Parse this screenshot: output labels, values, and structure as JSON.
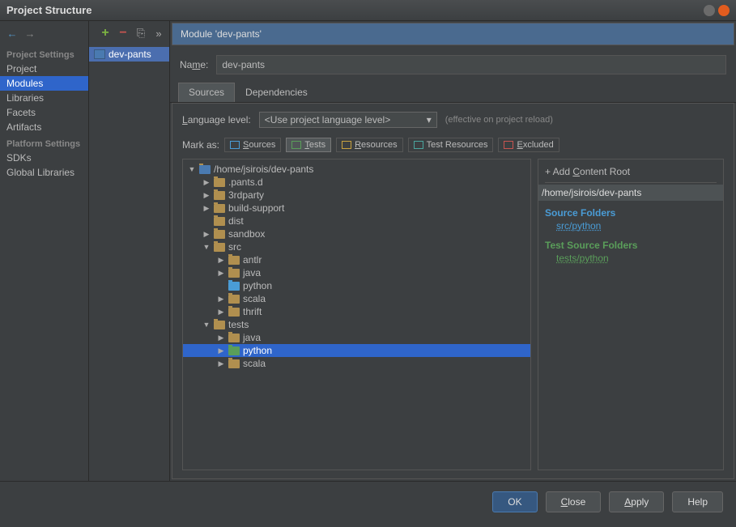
{
  "window": {
    "title": "Project Structure"
  },
  "nav": {
    "left_icon": "←",
    "right_icon": "→"
  },
  "sidebar": {
    "group1": "Project Settings",
    "items1": [
      "Project",
      "Modules",
      "Libraries",
      "Facets",
      "Artifacts"
    ],
    "group2": "Platform Settings",
    "items2": [
      "SDKs",
      "Global Libraries"
    ],
    "selected": "Modules"
  },
  "mid": {
    "module": "dev-pants"
  },
  "main": {
    "title": "Module 'dev-pants'",
    "name_label": "Name:",
    "name_value": "dev-pants",
    "tabs": [
      "Sources",
      "Dependencies"
    ],
    "active_tab": "Sources",
    "lang_label": "Language level:",
    "lang_value": "<Use project language level>",
    "lang_hint": "(effective on project reload)",
    "mark_label": "Mark as:",
    "mark_sources": "Sources",
    "mark_tests": "Tests",
    "mark_resources": "Resources",
    "mark_test_resources": "Test Resources",
    "mark_excluded": "Excluded"
  },
  "tree": {
    "root": "/home/jsirois/dev-pants",
    "items": [
      {
        "lvl": 0,
        "exp": "▼",
        "cls": "mod",
        "label": "/home/jsirois/dev-pants"
      },
      {
        "lvl": 1,
        "exp": "▶",
        "cls": "",
        "label": ".pants.d"
      },
      {
        "lvl": 1,
        "exp": "▶",
        "cls": "",
        "label": "3rdparty"
      },
      {
        "lvl": 1,
        "exp": "▶",
        "cls": "",
        "label": "build-support"
      },
      {
        "lvl": 1,
        "exp": "",
        "cls": "",
        "label": "dist"
      },
      {
        "lvl": 1,
        "exp": "▶",
        "cls": "",
        "label": "sandbox"
      },
      {
        "lvl": 1,
        "exp": "▼",
        "cls": "",
        "label": "src"
      },
      {
        "lvl": 2,
        "exp": "▶",
        "cls": "",
        "label": "antlr"
      },
      {
        "lvl": 2,
        "exp": "▶",
        "cls": "",
        "label": "java"
      },
      {
        "lvl": 2,
        "exp": "",
        "cls": "blue",
        "label": "python"
      },
      {
        "lvl": 2,
        "exp": "▶",
        "cls": "",
        "label": "scala"
      },
      {
        "lvl": 2,
        "exp": "▶",
        "cls": "",
        "label": "thrift"
      },
      {
        "lvl": 1,
        "exp": "▼",
        "cls": "",
        "label": "tests"
      },
      {
        "lvl": 2,
        "exp": "▶",
        "cls": "",
        "label": "java"
      },
      {
        "lvl": 2,
        "exp": "▶",
        "cls": "green",
        "label": "python",
        "selected": true
      },
      {
        "lvl": 2,
        "exp": "▶",
        "cls": "",
        "label": "scala"
      }
    ]
  },
  "right": {
    "add_root": "+ Add Content Root",
    "root_path": "/home/jsirois/dev-pants",
    "source_folders_label": "Source Folders",
    "source_folders": [
      "src/python"
    ],
    "test_source_folders_label": "Test Source Folders",
    "test_source_folders": [
      "tests/python"
    ]
  },
  "buttons": {
    "ok": "OK",
    "close": "Close",
    "apply": "Apply",
    "help": "Help"
  }
}
